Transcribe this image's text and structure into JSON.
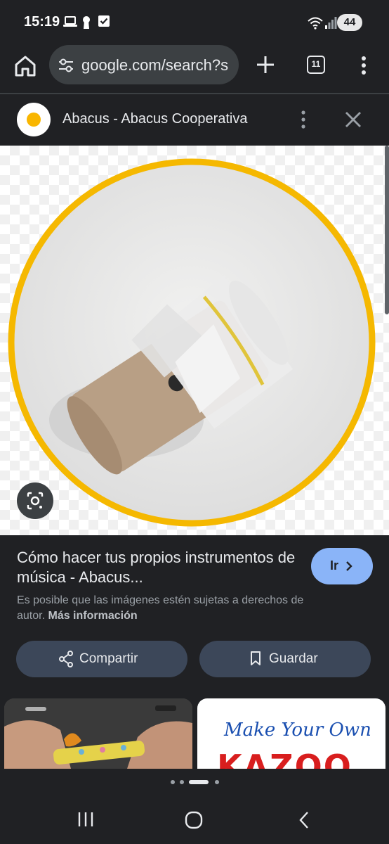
{
  "status_bar": {
    "time": "15:19",
    "battery": "44"
  },
  "browser": {
    "url": "google.com/search?s",
    "tab_count": "11"
  },
  "result_header": {
    "title": "Abacus - Abacus Cooperativa"
  },
  "result": {
    "title": "Cómo hacer tus propios instrumentos de música - Abacus...",
    "go_label": "Ir",
    "copyright_text": "Es posible que las imágenes estén sujetas a derechos de autor.",
    "more_info": "Más información",
    "share_label": "Compartir",
    "save_label": "Guardar"
  },
  "thumbnails": {
    "second_line1": "Make Your Own",
    "second_line2": "KAZOO"
  },
  "colors": {
    "accent": "#8ab4f8",
    "logo_ring": "#f9b600",
    "kazoo_red": "#d81e1e",
    "kazoo_blue": "#1a4fb0"
  }
}
